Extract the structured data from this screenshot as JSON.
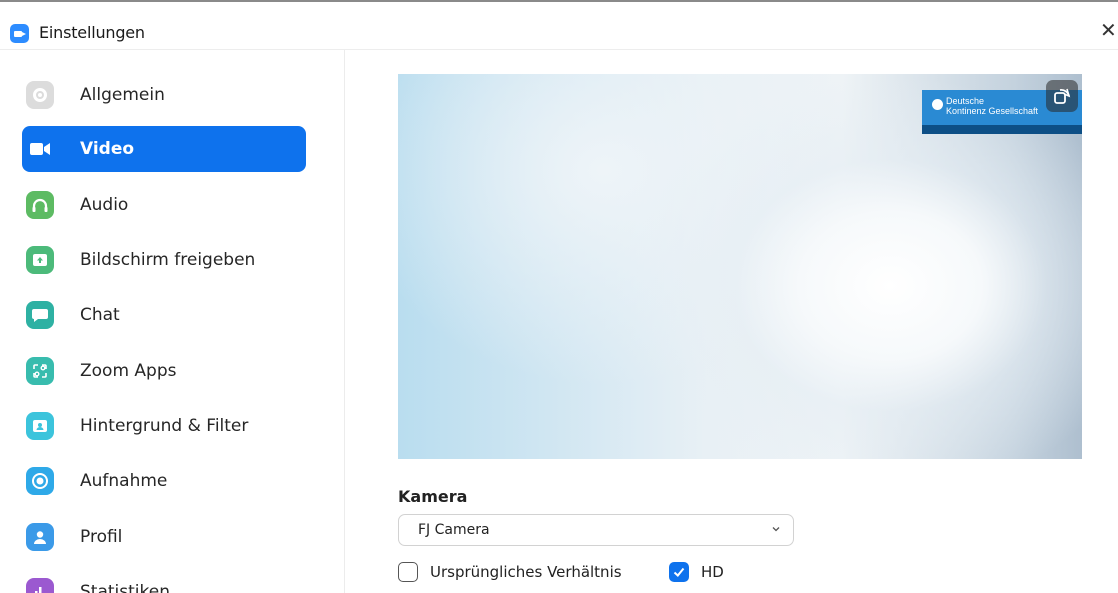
{
  "window": {
    "title": "Einstellungen",
    "close_symbol": "✕"
  },
  "sidebar": {
    "items": [
      {
        "label": "Allgemein",
        "icon": "gear-icon",
        "color": "#dcdcdc",
        "active": false
      },
      {
        "label": "Video",
        "icon": "video-camera-icon",
        "color": "#0e72ed",
        "active": true
      },
      {
        "label": "Audio",
        "icon": "headphones-icon",
        "color": "#5dbb63",
        "active": false
      },
      {
        "label": "Bildschirm freigeben",
        "icon": "share-screen-icon",
        "color": "#4cba7a",
        "active": false
      },
      {
        "label": "Chat",
        "icon": "chat-bubble-icon",
        "color": "#2eb1a3",
        "active": false
      },
      {
        "label": "Zoom Apps",
        "icon": "apps-icon",
        "color": "#38bcae",
        "active": false
      },
      {
        "label": "Hintergrund & Filter",
        "icon": "background-filter-icon",
        "color": "#3cc4dc",
        "active": false
      },
      {
        "label": "Aufnahme",
        "icon": "record-icon",
        "color": "#2ea9e8",
        "active": false
      },
      {
        "label": "Profil",
        "icon": "profile-icon",
        "color": "#3b9ae8",
        "active": false
      },
      {
        "label": "Statistiken",
        "icon": "statistics-icon",
        "color": "#9b59d0",
        "active": false
      }
    ]
  },
  "preview": {
    "banner_line1": "Deutsche",
    "banner_line2": "Kontinenz Gesellschaft",
    "rotate_icon": "rotate-camera-icon"
  },
  "camera": {
    "section_label": "Kamera",
    "selected": "FJ Camera"
  },
  "options": {
    "original_ratio_label": "Ursprüngliches Verhältnis",
    "original_ratio_checked": false,
    "hd_label": "HD",
    "hd_checked": true
  },
  "colors": {
    "accent": "#0e72ed"
  }
}
